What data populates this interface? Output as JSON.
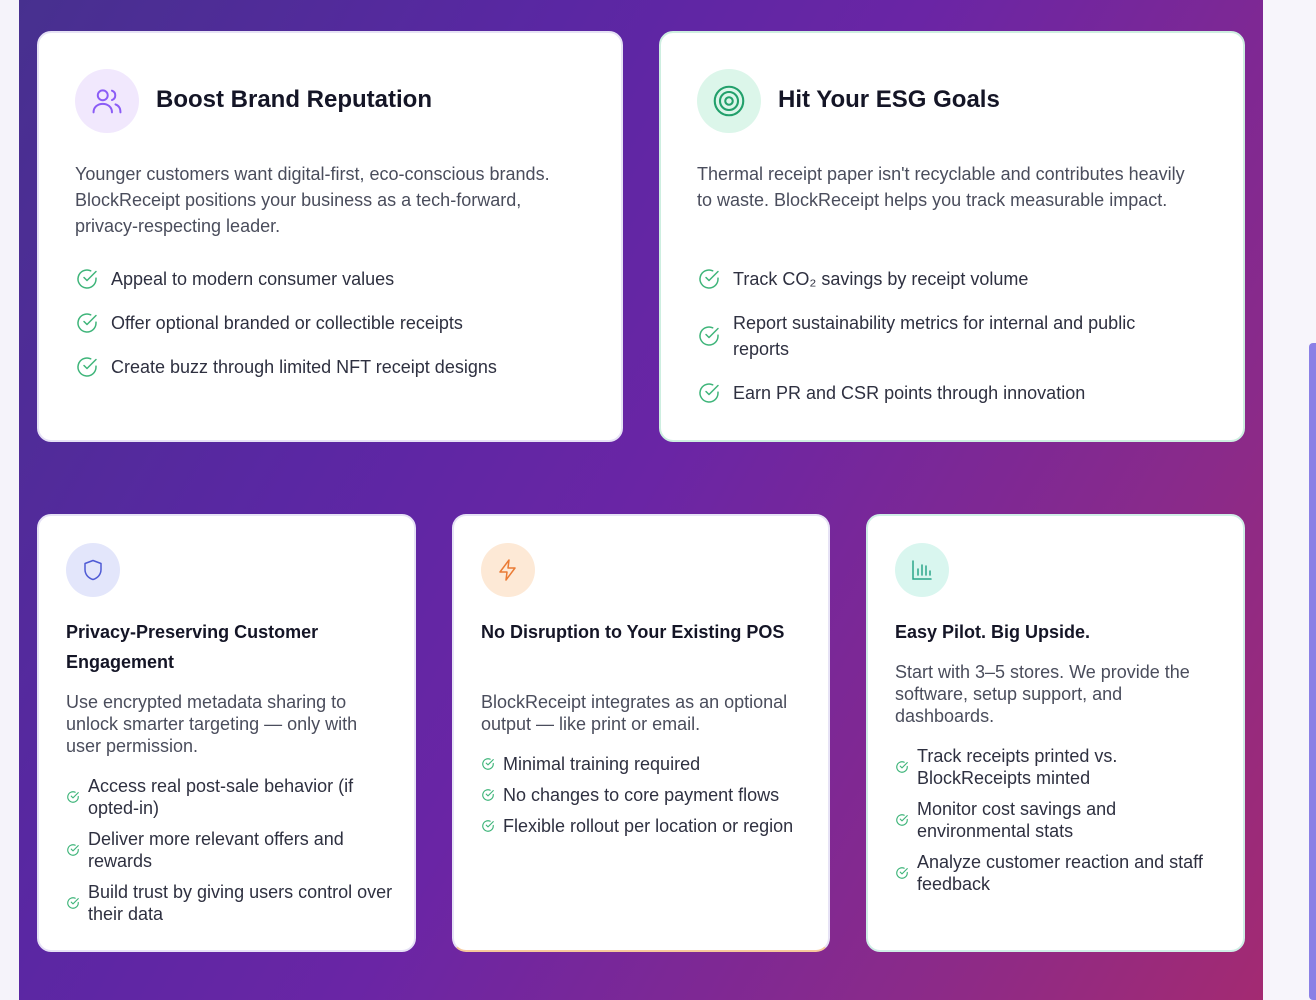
{
  "colors": {
    "accent_purple": "#8b5cf6",
    "accent_green": "#22a06b",
    "accent_orange": "#ea7b35",
    "accent_blue": "#4f5bd5",
    "check_green": "#3fb57a"
  },
  "cards": {
    "brand": {
      "icon": "users-icon",
      "title": "Boost Brand Reputation",
      "description": "Younger customers want digital-first, eco-conscious brands. BlockReceipt positions your business as a tech-forward, privacy-respecting leader.",
      "items": [
        "Appeal to modern consumer values",
        "Offer optional branded or collectible receipts",
        "Create buzz through limited NFT receipt designs"
      ]
    },
    "esg": {
      "icon": "target-icon",
      "title": "Hit Your ESG Goals",
      "description": "Thermal receipt paper isn't recyclable and contributes heavily to waste. BlockReceipt helps you track measurable impact.",
      "items": [
        "Track CO₂ savings by receipt volume",
        "Report sustainability metrics for internal and public reports",
        "Earn PR and CSR points through innovation"
      ]
    },
    "privacy": {
      "icon": "shield-icon",
      "title": "Privacy-Preserving Customer Engagement",
      "description": "Use encrypted metadata sharing to unlock smarter targeting — only with user permission.",
      "items": [
        "Access real post-sale behavior (if opted-in)",
        "Deliver more relevant offers and rewards",
        "Build trust by giving users control over their data"
      ]
    },
    "pos": {
      "icon": "lightning-icon",
      "title": "No Disruption to Your Existing POS",
      "description": "BlockReceipt integrates as an optional output — like print or email.",
      "items": [
        "Minimal training required",
        "No changes to core payment flows",
        "Flexible rollout per location or region"
      ]
    },
    "pilot": {
      "icon": "bar-chart-icon",
      "title": "Easy Pilot. Big Upside.",
      "description": "Start with 3–5 stores. We provide the software, setup support, and dashboards.",
      "items": [
        "Track receipts printed vs. BlockReceipts minted",
        "Monitor cost savings and environmental stats",
        "Analyze customer reaction and staff feedback"
      ]
    }
  }
}
